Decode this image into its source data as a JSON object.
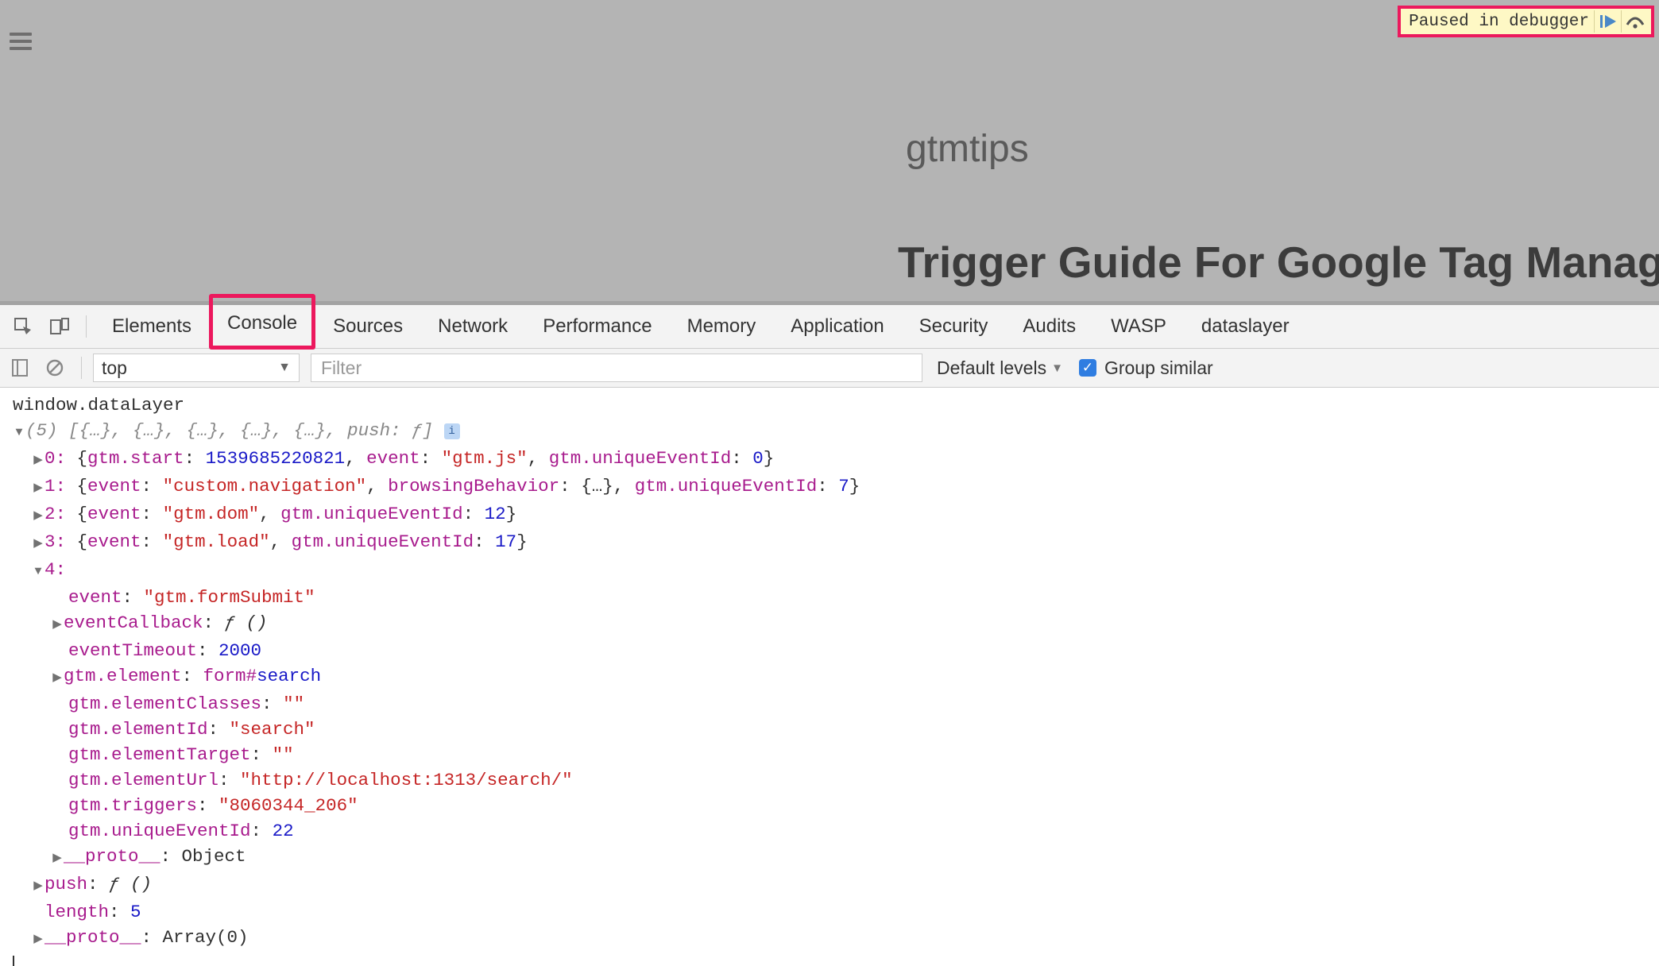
{
  "page": {
    "site_title": "gtmtips",
    "article_title": "Trigger Guide For Google Tag Manage"
  },
  "debugger": {
    "paused_text": "Paused in debugger"
  },
  "devtools_tabs": {
    "elements": "Elements",
    "console": "Console",
    "sources": "Sources",
    "network": "Network",
    "performance": "Performance",
    "memory": "Memory",
    "application": "Application",
    "security": "Security",
    "audits": "Audits",
    "wasp": "WASP",
    "dataslayer": "dataslayer"
  },
  "console_toolbar": {
    "context": "top",
    "filter_placeholder": "Filter",
    "levels": "Default levels",
    "group_similar": "Group similar"
  },
  "console": {
    "input": "window.dataLayer",
    "array_header_a": "(5) [{…}, {…}, {…}, {…}, {…}, ",
    "array_header_b": "push: ƒ",
    "array_header_c": "]",
    "item0": {
      "idx": "0:",
      "brace_l": " {",
      "p1k": "gtm.start",
      "p1v": "1539685220821",
      "p2k": "event",
      "p2v": "\"gtm.js\"",
      "p3k": "gtm.uniqueEventId",
      "p3v": "0",
      "brace_r": "}"
    },
    "item1": {
      "idx": "1:",
      "brace_l": " {",
      "p1k": "event",
      "p1v": "\"custom.navigation\"",
      "p2k": "browsingBehavior",
      "p2v": "{…}",
      "p3k": "gtm.uniqueEventId",
      "p3v": "7",
      "brace_r": "}"
    },
    "item2": {
      "idx": "2:",
      "brace_l": " {",
      "p1k": "event",
      "p1v": "\"gtm.dom\"",
      "p2k": "gtm.uniqueEventId",
      "p2v": "12",
      "brace_r": "}"
    },
    "item3": {
      "idx": "3:",
      "brace_l": " {",
      "p1k": "event",
      "p1v": "\"gtm.load\"",
      "p2k": "gtm.uniqueEventId",
      "p2v": "17",
      "brace_r": "}"
    },
    "item4_idx": "4:",
    "item4": {
      "event_k": "event",
      "event_v": "\"gtm.formSubmit\"",
      "cb_k": "eventCallback",
      "cb_v": "ƒ ()",
      "timeout_k": "eventTimeout",
      "timeout_v": "2000",
      "el_k": "gtm.element",
      "el_v1": "form",
      "el_hash": "#",
      "el_v2": "search",
      "classes_k": "gtm.elementClasses",
      "classes_v": "\"\"",
      "id_k": "gtm.elementId",
      "id_v": "\"search\"",
      "target_k": "gtm.elementTarget",
      "target_v": "\"\"",
      "url_k": "gtm.elementUrl",
      "url_v": "\"http://localhost:1313/search/\"",
      "triggers_k": "gtm.triggers",
      "triggers_v": "\"8060344_206\"",
      "ueid_k": "gtm.uniqueEventId",
      "ueid_v": "22",
      "proto_k": "__proto__",
      "proto_v": "Object"
    },
    "push_k": "push",
    "push_v": "ƒ ()",
    "length_k": "length",
    "length_v": "5",
    "arrproto_k": "__proto__",
    "arrproto_v": "Array(0)"
  }
}
